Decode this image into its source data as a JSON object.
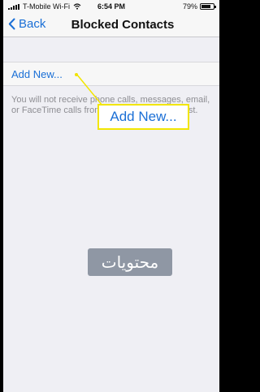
{
  "status_bar": {
    "carrier": "T-Mobile Wi-Fi",
    "time": "6:54 PM",
    "battery": "79%"
  },
  "nav": {
    "back_label": "Back",
    "title": "Blocked Contacts"
  },
  "list": {
    "add_new_label": "Add New..."
  },
  "footer": {
    "text": "You will not receive phone calls, messages, email, or FaceTime calls from people on the block list."
  },
  "callout": {
    "label": "Add New..."
  },
  "watermark": {
    "text": "محتويات"
  },
  "colors": {
    "accent": "#1a6fd6",
    "highlight": "#f2e600",
    "background": "#efeff4"
  }
}
